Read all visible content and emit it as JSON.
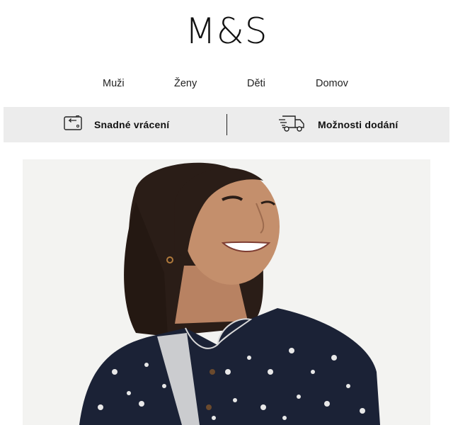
{
  "brand": {
    "logo": "M&S"
  },
  "nav": {
    "items": [
      {
        "label": "Muži"
      },
      {
        "label": "Ženy"
      },
      {
        "label": "Děti"
      },
      {
        "label": "Domov"
      }
    ]
  },
  "services": {
    "returns": {
      "label": "Snadné vrácení",
      "icon": "return-tag-icon"
    },
    "delivery": {
      "label": "Možnosti dodání",
      "icon": "delivery-truck-icon"
    }
  },
  "hero": {
    "image": "smiling-woman-in-floral-print-blouse"
  },
  "colors": {
    "service_bar_bg": "#ececec",
    "hero_bg": "#f3f3f1",
    "blouse": "#1b2236",
    "hair": "#2a1d17",
    "skin": "#c48f6c"
  }
}
